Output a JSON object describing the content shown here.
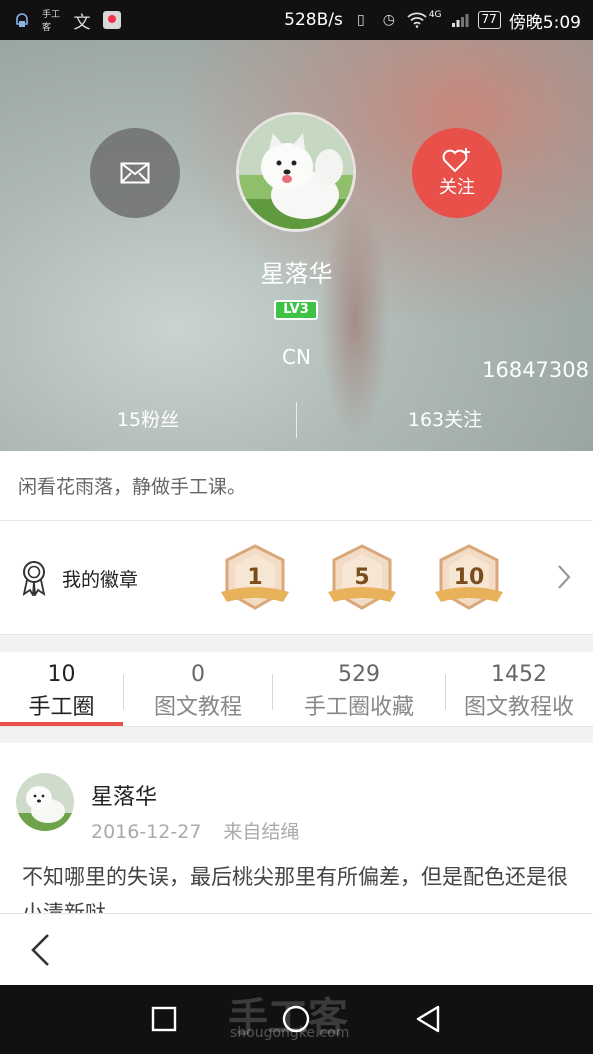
{
  "status_bar": {
    "left_icons": [
      "notification-icon",
      "app-icon",
      "maps-icon"
    ],
    "speed": "528B/s",
    "signal": "4G",
    "battery": "77",
    "time": "傍晚5:09"
  },
  "profile": {
    "username": "星落华",
    "level": "LV3",
    "country": "CN",
    "user_id": "16847308",
    "follow_label": "关注",
    "fans": "15粉丝",
    "following": "163关注",
    "bio": "闲看花雨落，静做手工课。"
  },
  "badges": {
    "title": "我的徽章",
    "items": [
      "1",
      "5",
      "10"
    ]
  },
  "tabs": [
    {
      "count": "10",
      "label": "手工圈"
    },
    {
      "count": "0",
      "label": "图文教程"
    },
    {
      "count": "529",
      "label": "手工圈收藏"
    },
    {
      "count": "1452",
      "label": "图文教程收"
    }
  ],
  "post": {
    "author": "星落华",
    "date": "2016-12-27",
    "source": "来自结绳",
    "text": "不知哪里的失误，最后桃尖那里有所偏差，但是配色还是很小清新哒"
  },
  "watermark": {
    "main": "手工客",
    "sub": "shougongke.com"
  },
  "colors": {
    "accent": "#e9504a",
    "level_green": "#3ec346"
  }
}
